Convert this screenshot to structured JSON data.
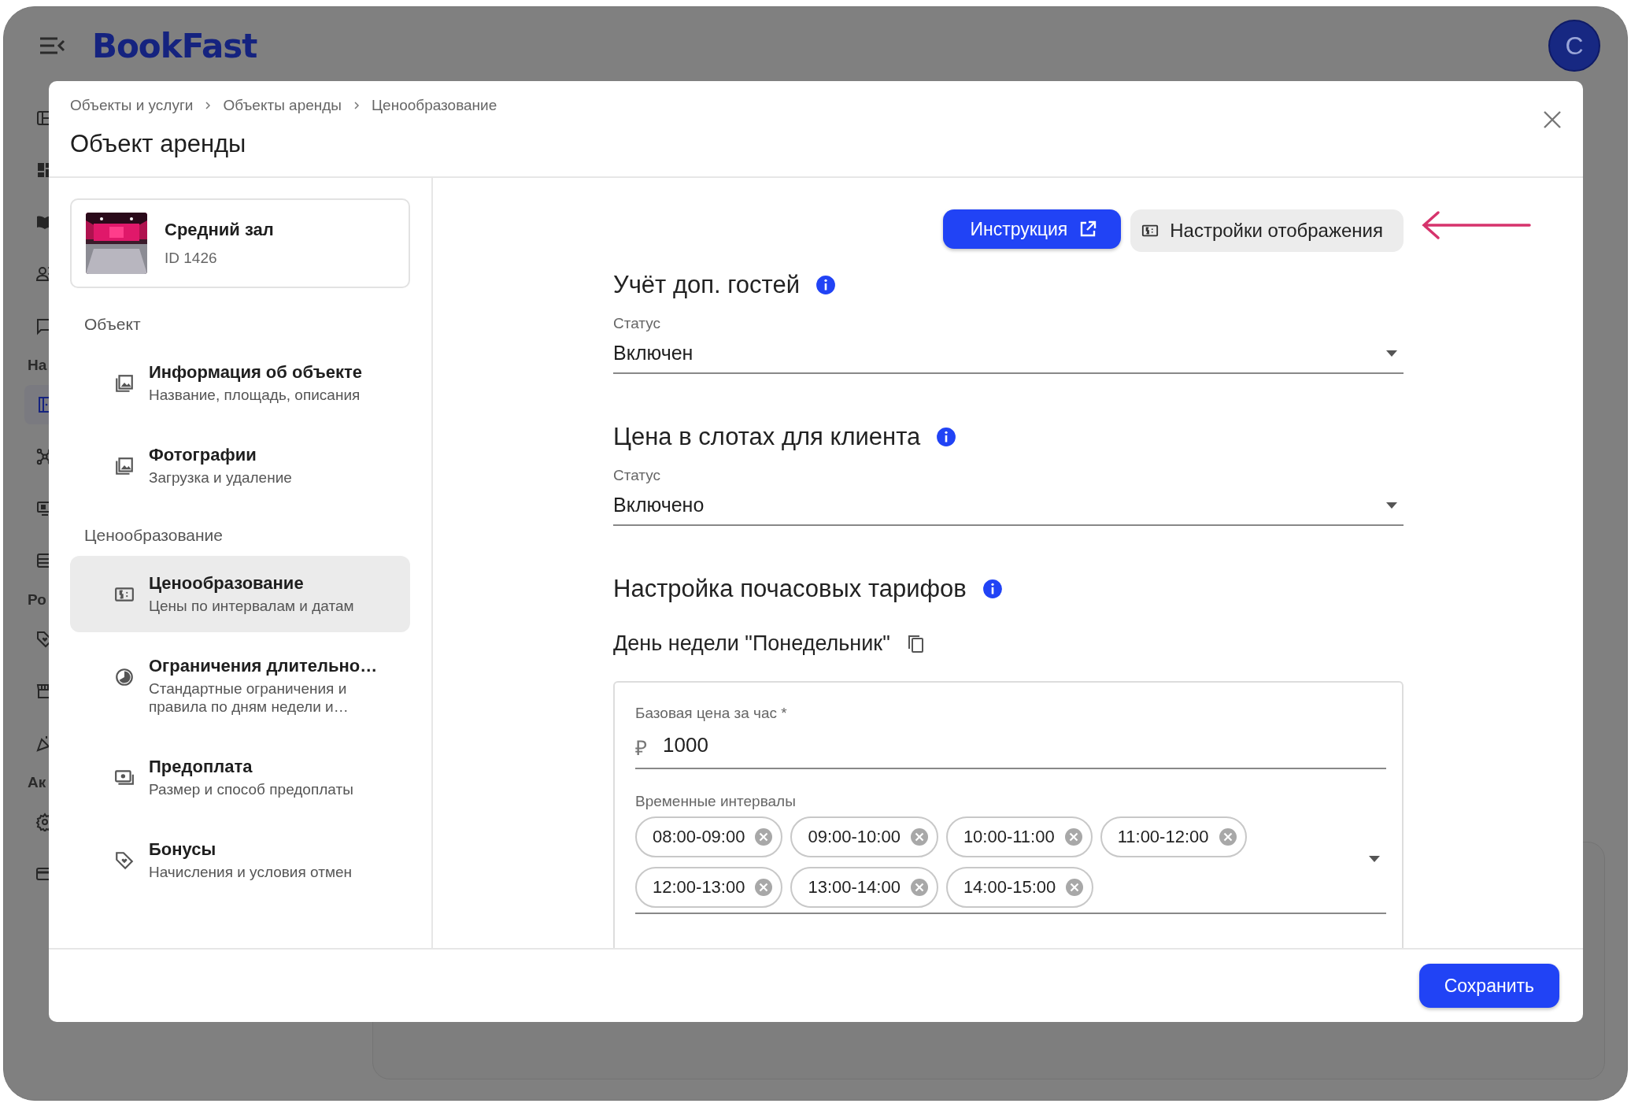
{
  "app": {
    "logo": "BookFast",
    "avatar": "С",
    "rail": [
      {
        "kind": "icon",
        "selected": false
      },
      {
        "kind": "icon",
        "selected": false
      },
      {
        "kind": "icon",
        "selected": false
      },
      {
        "kind": "icon",
        "selected": false
      },
      {
        "kind": "icon",
        "selected": false
      },
      {
        "kind": "label",
        "text": "На"
      },
      {
        "kind": "icon",
        "selected": true
      },
      {
        "kind": "icon",
        "selected": false
      },
      {
        "kind": "icon",
        "selected": false
      },
      {
        "kind": "icon",
        "selected": false
      },
      {
        "kind": "label",
        "text": "Ро"
      },
      {
        "kind": "icon",
        "selected": false
      },
      {
        "kind": "icon",
        "selected": false
      },
      {
        "kind": "icon",
        "selected": false
      },
      {
        "kind": "label",
        "text": "Ак"
      },
      {
        "kind": "icon",
        "selected": false
      },
      {
        "kind": "icon",
        "selected": false
      }
    ]
  },
  "modal": {
    "breadcrumbs": [
      "Объекты и услуги",
      "Объекты аренды",
      "Ценообразование"
    ],
    "title": "Объект аренды",
    "object": {
      "name": "Средний зал",
      "id": "ID 1426"
    },
    "sections": [
      {
        "title": "Объект",
        "items": [
          {
            "title": "Информация об объекте",
            "subtitle": "Название, площадь, описания",
            "selected": false
          },
          {
            "title": "Фотографии",
            "subtitle": "Загрузка и удаление",
            "selected": false
          }
        ]
      },
      {
        "title": "Ценообразование",
        "items": [
          {
            "title": "Ценообразование",
            "subtitle": "Цены по интервалам и датам",
            "selected": true
          },
          {
            "title": "Ограничения длительно…",
            "subtitle": "Стандартные ограничения и правила по дням недели и…",
            "selected": false
          },
          {
            "title": "Предоплата",
            "subtitle": "Размер и способ предоплаты",
            "selected": false
          },
          {
            "title": "Бонусы",
            "subtitle": "Начисления и условия отмен",
            "selected": false
          }
        ]
      }
    ],
    "buttons": {
      "instruction": "Инструкция",
      "display_settings": "Настройки отображения"
    },
    "settings": [
      {
        "heading": "Учёт доп. гостей",
        "field_label": "Статус",
        "value": "Включен"
      },
      {
        "heading": "Цена в слотах для клиента",
        "field_label": "Статус",
        "value": "Включено"
      }
    ],
    "hourly": {
      "heading": "Настройка почасовых тарифов",
      "day": "День недели \"Понедельник\"",
      "price_label": "Базовая цена за час *",
      "currency": "₽",
      "price": "1000",
      "intervals_label": "Временные интервалы",
      "intervals": [
        "08:00-09:00",
        "09:00-10:00",
        "10:00-11:00",
        "11:00-12:00",
        "12:00-13:00",
        "13:00-14:00",
        "14:00-15:00"
      ]
    },
    "save": "Сохранить"
  }
}
